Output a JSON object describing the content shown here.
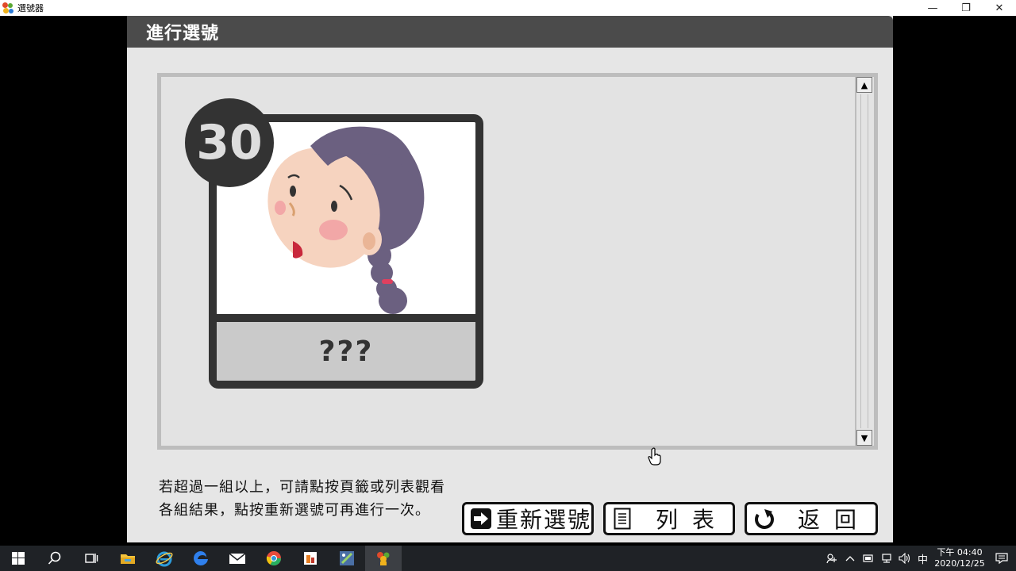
{
  "window": {
    "title": "選號器",
    "minimize": "—",
    "restore": "❐",
    "close": "✕"
  },
  "panel": {
    "title": "進行選號"
  },
  "card": {
    "number": "30",
    "name": "???"
  },
  "scrollbar": {
    "up": "▲",
    "down": "▼"
  },
  "instruction": {
    "line1": "若超過一組以上，可請點按頁籤或列表觀看",
    "line2": "各組結果，點按重新選號可再進行一次。"
  },
  "buttons": {
    "redraw": "重新選號",
    "list": "列表",
    "back": "返回"
  },
  "taskbar": {
    "ime": "中",
    "time": "下午 04:40",
    "date": "2020/12/25"
  },
  "colors": {
    "header": "#4b4b4b",
    "panel": "#e6e6e6",
    "hair": "#6b6080",
    "skin": "#f6d3bf",
    "blush": "#f2a7a7",
    "taskbar": "#1f2226"
  }
}
